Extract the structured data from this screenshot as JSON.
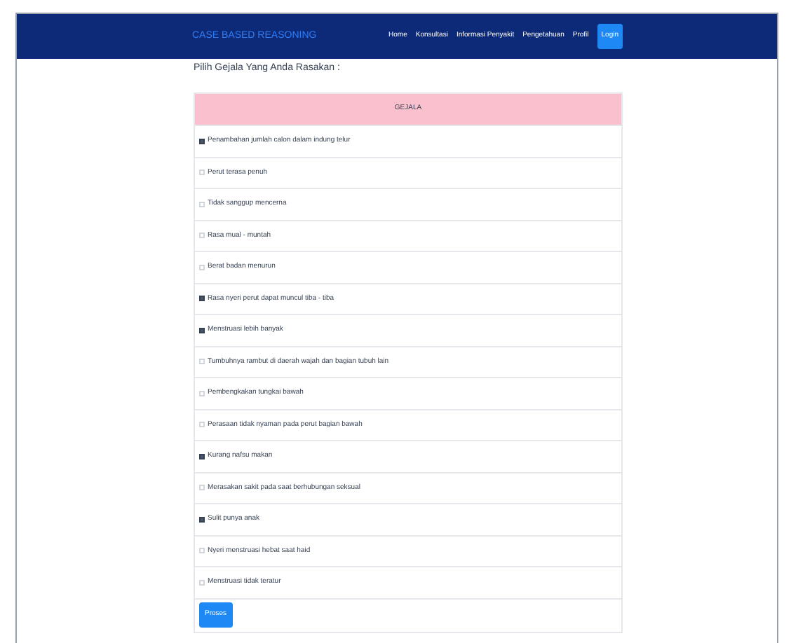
{
  "navbar": {
    "brand": "CASE BASED REASONING",
    "links": [
      {
        "label": "Home",
        "selected": false
      },
      {
        "label": "Konsultasi",
        "selected": false
      },
      {
        "label": "Informasi Penyakit",
        "selected": false
      },
      {
        "label": "Pengetahuan",
        "selected": false
      },
      {
        "label": "Profil",
        "selected": false
      },
      {
        "label": "Login",
        "selected": true
      }
    ]
  },
  "heading": "Pilih Gejala Yang Anda Rasakan :",
  "table": {
    "header": "GEJALA",
    "rows": [
      {
        "label": "Penambahan jumlah calon dalam indung telur",
        "checked": true
      },
      {
        "label": "Perut terasa penuh",
        "checked": false
      },
      {
        "label": "Tidak sanggup mencerna",
        "checked": false
      },
      {
        "label": "Rasa mual - muntah",
        "checked": false
      },
      {
        "label": "Berat badan menurun",
        "checked": false
      },
      {
        "label": "Rasa nyeri perut dapat muncul tiba - tiba",
        "checked": true
      },
      {
        "label": "Menstruasi lebih banyak",
        "checked": true
      },
      {
        "label": "Tumbuhnya rambut di daerah wajah dan bagian tubuh lain",
        "checked": false
      },
      {
        "label": "Pembengkakan tungkai bawah",
        "checked": false
      },
      {
        "label": "Perasaan tidak nyaman pada perut bagian bawah",
        "checked": false
      },
      {
        "label": "Kurang nafsu makan",
        "checked": true
      },
      {
        "label": "Merasakan sakit pada saat berhubungan seksual",
        "checked": false
      },
      {
        "label": "Sulit punya anak",
        "checked": true
      },
      {
        "label": "Nyeri menstruasi hebat saat haid",
        "checked": false
      },
      {
        "label": "Menstruasi tidak teratur",
        "checked": false
      }
    ]
  },
  "submit": "Proses"
}
